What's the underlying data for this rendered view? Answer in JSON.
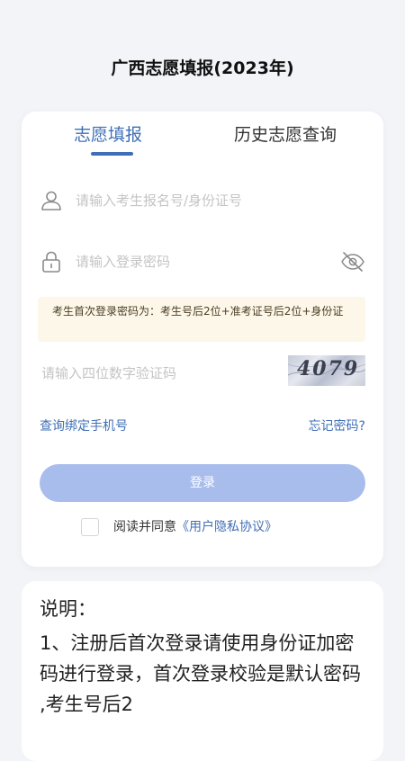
{
  "page": {
    "title": "广西志愿填报(2023年)"
  },
  "tabs": [
    {
      "label": "志愿填报",
      "active": true
    },
    {
      "label": "历史志愿查询",
      "active": false
    }
  ],
  "form": {
    "username_placeholder": "请输入考生报名号/身份证号",
    "password_placeholder": "请输入登录密码",
    "notice": "考生首次登录密码为：考生号后2位+准考证号后2位+身份证",
    "captcha_placeholder": "请输入四位数字验证码",
    "captcha_image_text": "4079",
    "bind_phone_link": "查询绑定手机号",
    "forgot_link": "忘记密码?",
    "login_label": "登录",
    "agree_prefix": "阅读并同意",
    "agree_link": "《用户隐私协议》"
  },
  "description": {
    "title": "说明：",
    "body": "1、注册后首次登录请使用身份证加密码进行登录，首次登录校验是默认密码 ,考生号后2"
  },
  "colors": {
    "accent": "#3f6fb6",
    "login_button": "#a9bdec",
    "notice_bg": "#fdf7ea",
    "background": "#f3f4f8"
  },
  "icons": {
    "username": "user-icon",
    "password": "lock-icon",
    "visibility": "eye-off-icon"
  }
}
